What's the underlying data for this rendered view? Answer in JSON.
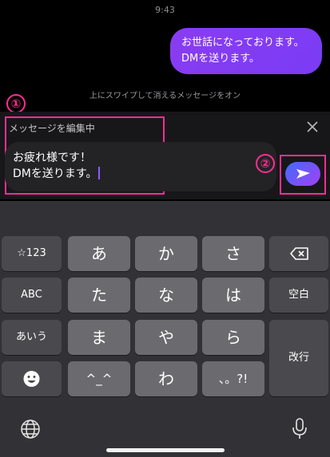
{
  "status_bar": {
    "time": "9:43"
  },
  "chat": {
    "sent_message": "お世話になっております。\nDMを送ります。",
    "ephemeral_hint": "上にスワイプして消えるメッセージをオン"
  },
  "annotations": {
    "one": "①",
    "two": "②",
    "highlight_color": "#ff2e92"
  },
  "editor": {
    "title": "メッセージを編集中",
    "text": "お疲れ様です！\nDMを送ります。",
    "close_icon": "close-icon",
    "send_icon": "paper-plane-icon"
  },
  "keyboard": {
    "row1": [
      "☆123",
      "あ",
      "か",
      "さ"
    ],
    "row2": [
      "ABC",
      "た",
      "な",
      "は",
      "空白"
    ],
    "row3": [
      "あいう",
      "ま",
      "や",
      "ら"
    ],
    "row4": [
      "^_^",
      "わ",
      "、。?!"
    ],
    "enter": "改行",
    "delete_icon": "backspace-icon",
    "emoji_icon": "emoji-icon",
    "globe_icon": "globe-icon",
    "mic_icon": "microphone-icon"
  },
  "colors": {
    "accent": "#7a3cf5",
    "send_gradient_start": "#3f6cff",
    "send_gradient_end": "#a43ff2"
  }
}
